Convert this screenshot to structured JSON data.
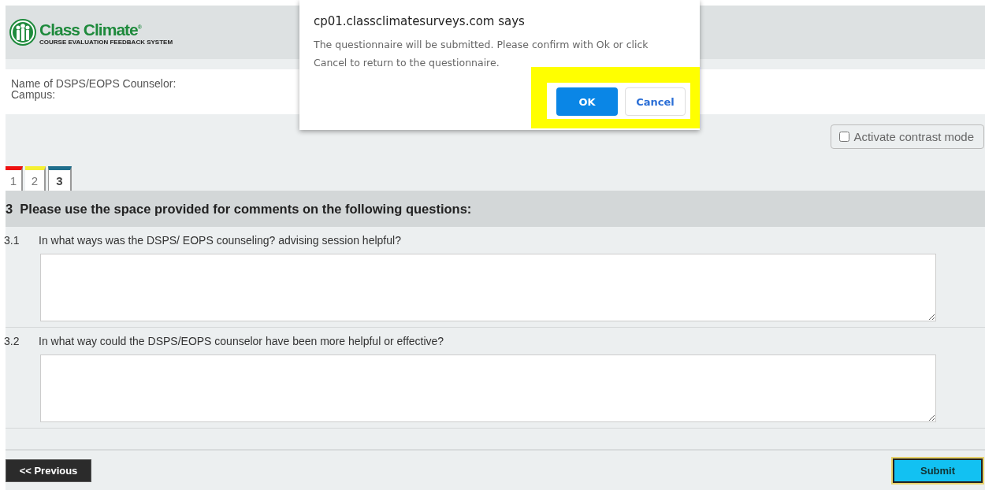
{
  "header": {
    "logo_text": "Class Climate",
    "logo_mark": "®",
    "logo_tagline": "COURSE EVALUATION FEEDBACK SYSTEM"
  },
  "info": [
    "Name of DSPS/EOPS Counselor:",
    "Campus:"
  ],
  "contrast_mode": {
    "label": "Activate contrast mode",
    "checked": false
  },
  "page_tabs": [
    {
      "label": "1",
      "color": "#ee1111",
      "selected": false
    },
    {
      "label": "2",
      "color": "#f5f032",
      "selected": false
    },
    {
      "label": "3",
      "color": "#1f6e8c",
      "selected": true
    }
  ],
  "section": {
    "number": "3",
    "title": "Please use the space provided for comments on the following questions:"
  },
  "questions": [
    {
      "number": "3.1",
      "text": "In what ways was the DSPS/ EOPS counseling? advising session helpful?"
    },
    {
      "number": "3.2",
      "text": "In what way could the DSPS/EOPS counselor have been more helpful or effective?"
    }
  ],
  "nav": {
    "previous": "<< Previous",
    "submit": "Submit"
  },
  "dialog": {
    "title": "cp01.classclimatesurveys.com says",
    "message": "The questionnaire will be submitted. Please confirm with Ok or click Cancel to return to the questionnaire.",
    "ok": "OK",
    "cancel": "Cancel",
    "buttons_highlighted": true
  }
}
